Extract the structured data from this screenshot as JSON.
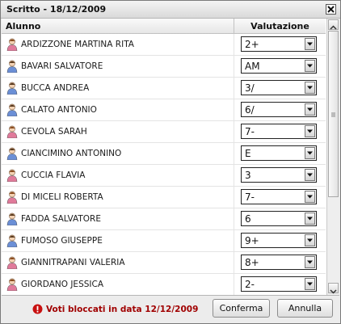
{
  "window": {
    "title": "Scritto - 18/12/2009"
  },
  "grid": {
    "columns": {
      "name": "Alunno",
      "grade": "Valutazione"
    },
    "rows": [
      {
        "name": "ARDIZZONE MARTINA RITA",
        "gender": "female",
        "grade": "2+"
      },
      {
        "name": "BAVARI SALVATORE",
        "gender": "male",
        "grade": "AM"
      },
      {
        "name": "BUCCA ANDREA",
        "gender": "male",
        "grade": "3/"
      },
      {
        "name": "CALATO ANTONIO",
        "gender": "male",
        "grade": "6/"
      },
      {
        "name": "CEVOLA SARAH",
        "gender": "female",
        "grade": "7-"
      },
      {
        "name": "CIANCIMINO ANTONINO",
        "gender": "male",
        "grade": "E"
      },
      {
        "name": "CUCCIA FLAVIA",
        "gender": "female",
        "grade": "3"
      },
      {
        "name": "DI MICELI ROBERTA",
        "gender": "female",
        "grade": "7-"
      },
      {
        "name": "FADDA SALVATORE",
        "gender": "male",
        "grade": "6"
      },
      {
        "name": "FUMOSO GIUSEPPE",
        "gender": "male",
        "grade": "9+"
      },
      {
        "name": "GIANNITRAPANI VALERIA",
        "gender": "female",
        "grade": "8+"
      },
      {
        "name": "GIORDANO JESSICA",
        "gender": "female",
        "grade": "2-"
      }
    ]
  },
  "footer": {
    "lock_message": "Voti bloccati in data 12/12/2009",
    "confirm_label": "Conferma",
    "cancel_label": "Annulla"
  },
  "colors": {
    "female_avatar": "#e07a9a",
    "male_avatar": "#6b8fd6",
    "lock_text": "#a00000"
  }
}
